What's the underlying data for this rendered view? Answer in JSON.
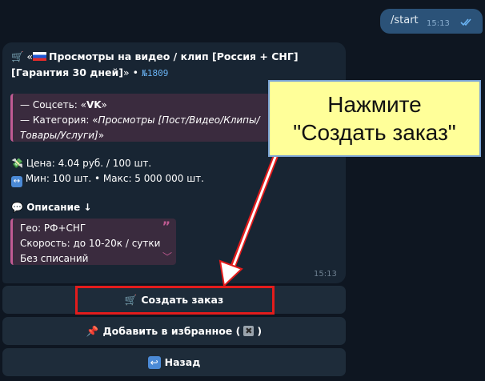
{
  "chat": {
    "outgoing": {
      "text": "/start",
      "time": "15:13"
    },
    "incoming": {
      "title_prefix": "«",
      "title_bold": "Просмотры на видео / клип [Россия + СНГ] [Гарантия 30 дней]",
      "title_suffix": "» •",
      "title_link": "№1809",
      "quote1": {
        "line1_prefix": "— Соцсеть: «",
        "line1_value": "VK",
        "line1_suffix": "»",
        "line2_prefix": "— Категория: «",
        "line2_value": "Просмотры [Пост/Видео/Клипы/Товары/Услуги]",
        "line2_suffix": "»"
      },
      "price": "Цена: 4.04 руб. / 100 шт.",
      "minmax": "Мин: 100 шт. • Макс: 5 000 000 шт.",
      "description_label": "Описание ↓",
      "quote2_lines": [
        "Гео: РФ+СНГ",
        "Скорость: до 10-20к / сутки",
        "Без списаний"
      ],
      "time": "15:13"
    }
  },
  "keyboard": {
    "create_order": "Создать заказ",
    "add_favorite_prefix": "Добавить в избранное (",
    "add_favorite_suffix": ")",
    "back": "Назад"
  },
  "annotation": {
    "callout_line1": "Нажмите",
    "callout_line2": "\"Создать заказ\"",
    "highlight_color": "#e31c1c",
    "callout_bg": "#ffff99"
  },
  "icons": {
    "cart": "shopping-cart-icon",
    "money": "money-with-wings-icon",
    "arrows": "left-right-arrow-icon",
    "speech": "speech-bubble-icon",
    "pin": "pushpin-icon",
    "cross": "cross-mark-icon",
    "back": "back-arrow-icon"
  }
}
